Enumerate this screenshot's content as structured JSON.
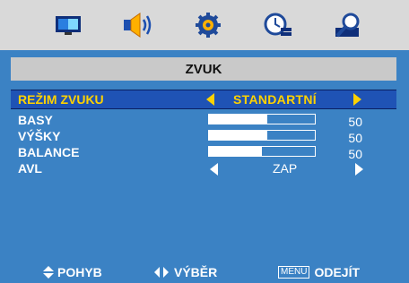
{
  "top_icons": [
    "picture-icon",
    "speaker-icon",
    "gear-icon",
    "clock-icon",
    "magnifier-icon"
  ],
  "title": "ZVUK",
  "rows": [
    {
      "label": "REŽIM ZVUKU",
      "value": "STANDARTNÍ"
    },
    {
      "label": "BASY",
      "value": "50",
      "level": 0.5
    },
    {
      "label": "VÝŠKY",
      "value": "50",
      "level": 0.5
    },
    {
      "label": "BALANCE",
      "value": "50",
      "level": 0.5
    },
    {
      "label": "AVL",
      "value": "ZAP"
    }
  ],
  "footer": {
    "move": "POHYB",
    "select": "VÝBĚR",
    "menu_key": "MENU",
    "exit": "ODEJÍT"
  },
  "colors": {
    "panel": "#3b82c4",
    "highlight": "#1f53b5",
    "accent": "#ffd200",
    "topbar": "#d9d9d9"
  }
}
